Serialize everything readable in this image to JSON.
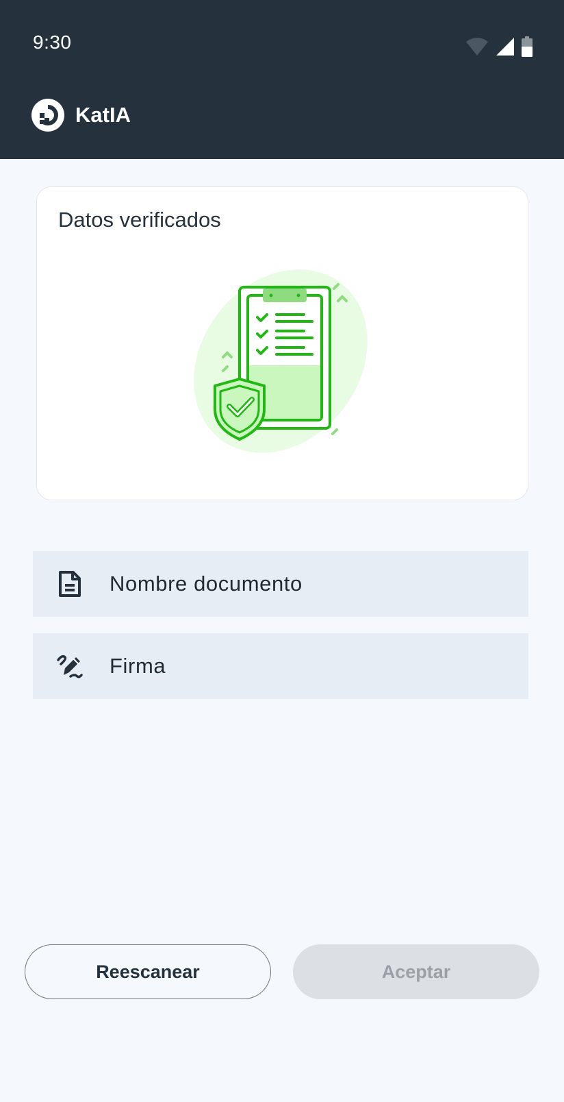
{
  "status_bar": {
    "time": "9:30",
    "icons": [
      "wifi-icon",
      "cell-signal-icon",
      "battery-icon"
    ]
  },
  "app_bar": {
    "logo": "katia-logo-icon",
    "title": "KatIA"
  },
  "card": {
    "title": "Datos verificados",
    "illustration": "verified-clipboard-shield-illustration"
  },
  "list": {
    "items": [
      {
        "icon": "document-icon",
        "label": "Nombre documento"
      },
      {
        "icon": "signature-pen-icon",
        "label": "Firma"
      }
    ]
  },
  "actions": {
    "rescan_label": "Reescanear",
    "accept_label": "Aceptar",
    "accept_disabled": true
  },
  "colors": {
    "header_bg": "#25323d",
    "page_bg": "#f5f9fe",
    "list_item_bg": "#e6edf5",
    "accent_green": "#22b814",
    "disabled_bg": "#dcdfe3",
    "disabled_text": "#9aa0a6"
  }
}
